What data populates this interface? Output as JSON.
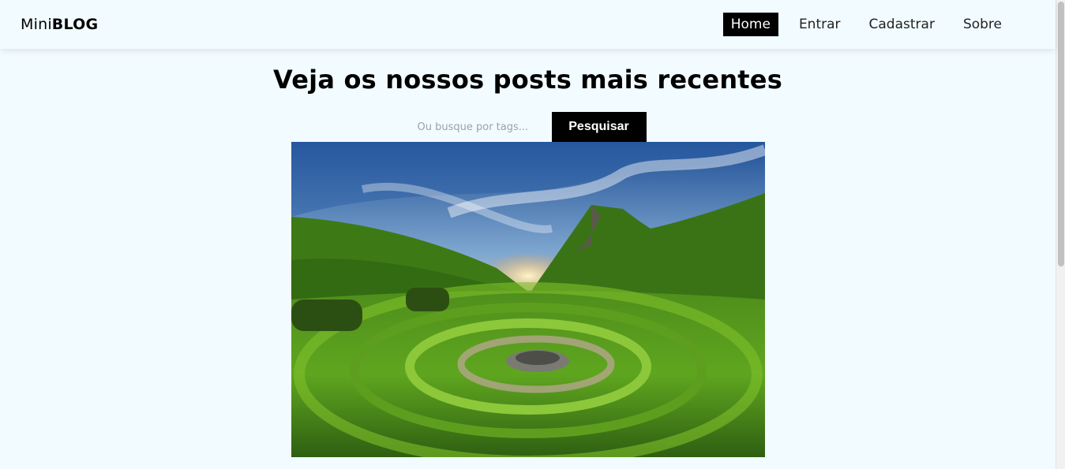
{
  "navbar": {
    "brand_light": "Mini",
    "brand_bold": "BLOG",
    "links": [
      "Home",
      "Entrar",
      "Cadastrar",
      "Sobre"
    ],
    "active": "Home"
  },
  "main": {
    "title": "Veja os nossos posts mais recentes",
    "search": {
      "placeholder": "Ou busque por tags...",
      "button_label": "Pesquisar"
    }
  },
  "colors": {
    "background": "#f2fbff",
    "accent": "#000000"
  },
  "icons": []
}
